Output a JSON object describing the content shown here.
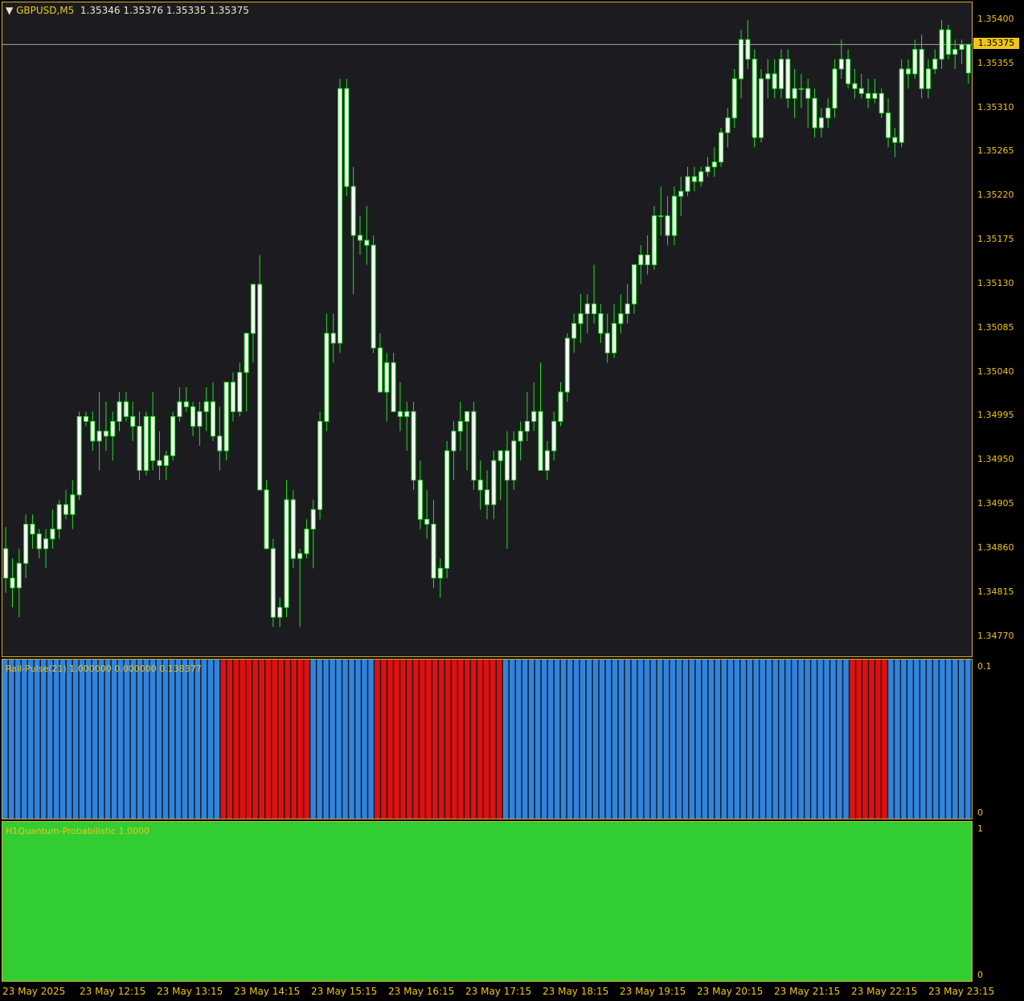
{
  "main": {
    "symbol": "GBPUSD,M5",
    "ohlc": "1.35346 1.35376 1.35335 1.35375",
    "current_price": "1.35375",
    "price_min": 1.3475,
    "price_max": 1.35418,
    "price_labels": [
      "1.35400",
      "1.35355",
      "1.35310",
      "1.35265",
      "1.35220",
      "1.35175",
      "1.35130",
      "1.35085",
      "1.35040",
      "1.34995",
      "1.34950",
      "1.34905",
      "1.34860",
      "1.34815",
      "1.34770"
    ],
    "colors": {
      "background": "#1c1c20",
      "bull_body": "#ffffff",
      "bear_body": "#ffffff",
      "wick": "#22e022",
      "bid_line": "#a0a0a0"
    }
  },
  "pulse": {
    "title": "Rail-Pulse(21) 1.000000 0.000000 0.138377",
    "axis_top": "0.1",
    "axis_bottom": "0",
    "colors": {
      "up": "#2f84e0",
      "down": "#e01010"
    }
  },
  "quantum": {
    "title": "H1Quantum-Probabilistic 1.0000",
    "axis_top": "1",
    "axis_bottom": "0",
    "value": 1.0,
    "colors": {
      "fill": "#32cd32"
    }
  },
  "time_axis": {
    "labels": [
      "23 May 2025",
      "23 May 12:15",
      "23 May 13:15",
      "23 May 14:15",
      "23 May 15:15",
      "23 May 16:15",
      "23 May 17:15",
      "23 May 18:15",
      "23 May 19:15",
      "23 May 20:15",
      "23 May 21:15",
      "23 May 22:15",
      "23 May 23:15"
    ]
  },
  "chart_data": {
    "type": "candlestick",
    "title": "GBPUSD,M5",
    "x_labels": [
      "23 May 2025",
      "23 May 12:15",
      "23 May 13:15",
      "23 May 14:15",
      "23 May 15:15",
      "23 May 16:15",
      "23 May 17:15",
      "23 May 18:15",
      "23 May 19:15",
      "23 May 20:15",
      "23 May 21:15",
      "23 May 22:15",
      "23 May 23:15"
    ],
    "ylim": [
      1.3475,
      1.35418
    ],
    "candles": [
      [
        1.3486,
        1.34882,
        1.34815,
        1.3483
      ],
      [
        1.3483,
        1.3485,
        1.348,
        1.3482
      ],
      [
        1.3482,
        1.3486,
        1.3479,
        1.34845
      ],
      [
        1.34845,
        1.34895,
        1.3483,
        1.34885
      ],
      [
        1.34885,
        1.34895,
        1.3486,
        1.34875
      ],
      [
        1.34875,
        1.3488,
        1.3485,
        1.3486
      ],
      [
        1.3486,
        1.3488,
        1.3484,
        1.3487
      ],
      [
        1.3487,
        1.349,
        1.3486,
        1.3488
      ],
      [
        1.3488,
        1.3491,
        1.3487,
        1.34905
      ],
      [
        1.34905,
        1.3492,
        1.3489,
        1.34895
      ],
      [
        1.34895,
        1.3493,
        1.3488,
        1.34915
      ],
      [
        1.34915,
        1.35,
        1.3491,
        1.34995
      ],
      [
        1.34995,
        1.35,
        1.34985,
        1.3499
      ],
      [
        1.3499,
        1.35,
        1.3496,
        1.3497
      ],
      [
        1.3497,
        1.3502,
        1.3494,
        1.3498
      ],
      [
        1.3498,
        1.3501,
        1.3496,
        1.34975
      ],
      [
        1.34975,
        1.35,
        1.3495,
        1.3499
      ],
      [
        1.3499,
        1.3502,
        1.3498,
        1.3501
      ],
      [
        1.3501,
        1.3502,
        1.3499,
        1.34995
      ],
      [
        1.34995,
        1.3501,
        1.3497,
        1.34985
      ],
      [
        1.34985,
        1.35,
        1.3493,
        1.3494
      ],
      [
        1.3494,
        1.35,
        1.34935,
        1.34995
      ],
      [
        1.34995,
        1.3502,
        1.3494,
        1.3495
      ],
      [
        1.3495,
        1.3498,
        1.3493,
        1.34945
      ],
      [
        1.34945,
        1.3496,
        1.3493,
        1.34955
      ],
      [
        1.34955,
        1.35,
        1.3495,
        1.34995
      ],
      [
        1.34995,
        1.35025,
        1.3499,
        1.3501
      ],
      [
        1.3501,
        1.35025,
        1.35,
        1.35005
      ],
      [
        1.35005,
        1.3501,
        1.34975,
        1.34985
      ],
      [
        1.34985,
        1.3501,
        1.34965,
        1.35
      ],
      [
        1.35,
        1.35025,
        1.3498,
        1.3501
      ],
      [
        1.3501,
        1.3503,
        1.3497,
        1.34975
      ],
      [
        1.34975,
        1.35005,
        1.3494,
        1.3496
      ],
      [
        1.3496,
        1.3503,
        1.3495,
        1.3503
      ],
      [
        1.3503,
        1.3504,
        1.3499,
        1.35
      ],
      [
        1.35,
        1.3505,
        1.34995,
        1.3504
      ],
      [
        1.3504,
        1.3508,
        1.35,
        1.3508
      ],
      [
        1.3508,
        1.3513,
        1.3505,
        1.3513
      ],
      [
        1.3513,
        1.3516,
        1.3504,
        1.3492
      ],
      [
        1.3492,
        1.3493,
        1.3486,
        1.3486
      ],
      [
        1.3486,
        1.3487,
        1.3478,
        1.3479
      ],
      [
        1.3479,
        1.3481,
        1.3478,
        1.348
      ],
      [
        1.348,
        1.3493,
        1.3479,
        1.3491
      ],
      [
        1.3491,
        1.3492,
        1.3484,
        1.3485
      ],
      [
        1.3485,
        1.3486,
        1.3478,
        1.34855
      ],
      [
        1.34855,
        1.3489,
        1.3485,
        1.3488
      ],
      [
        1.3488,
        1.3491,
        1.3484,
        1.349
      ],
      [
        1.349,
        1.35,
        1.3489,
        1.3499
      ],
      [
        1.3499,
        1.351,
        1.3498,
        1.3508
      ],
      [
        1.3508,
        1.351,
        1.3505,
        1.3507
      ],
      [
        1.3507,
        1.3534,
        1.3506,
        1.3533
      ],
      [
        1.3533,
        1.3534,
        1.3522,
        1.3523
      ],
      [
        1.3523,
        1.3525,
        1.3512,
        1.3518
      ],
      [
        1.3518,
        1.352,
        1.3516,
        1.35175
      ],
      [
        1.35175,
        1.3521,
        1.3515,
        1.3517
      ],
      [
        1.3517,
        1.3518,
        1.3506,
        1.35065
      ],
      [
        1.35065,
        1.3508,
        1.3502,
        1.3502
      ],
      [
        1.3502,
        1.3506,
        1.3499,
        1.3505
      ],
      [
        1.3505,
        1.3506,
        1.35,
        1.35
      ],
      [
        1.35,
        1.3503,
        1.3498,
        1.34995
      ],
      [
        1.34995,
        1.3501,
        1.3496,
        1.35
      ],
      [
        1.35,
        1.3501,
        1.3492,
        1.3493
      ],
      [
        1.3493,
        1.3495,
        1.3488,
        1.3489
      ],
      [
        1.3489,
        1.3492,
        1.3487,
        1.34885
      ],
      [
        1.34885,
        1.3491,
        1.3482,
        1.3483
      ],
      [
        1.3483,
        1.3485,
        1.3481,
        1.3484
      ],
      [
        1.3484,
        1.3497,
        1.3483,
        1.3496
      ],
      [
        1.3496,
        1.3499,
        1.3493,
        1.3498
      ],
      [
        1.3498,
        1.3501,
        1.3496,
        1.3499
      ],
      [
        1.3499,
        1.35,
        1.3494,
        1.35
      ],
      [
        1.35,
        1.3501,
        1.3492,
        1.3493
      ],
      [
        1.3493,
        1.3495,
        1.349,
        1.3492
      ],
      [
        1.3492,
        1.3494,
        1.3489,
        1.34905
      ],
      [
        1.34905,
        1.3496,
        1.3489,
        1.3495
      ],
      [
        1.3495,
        1.3496,
        1.3491,
        1.3496
      ],
      [
        1.3496,
        1.3498,
        1.3486,
        1.3493
      ],
      [
        1.3493,
        1.3498,
        1.3492,
        1.3497
      ],
      [
        1.3497,
        1.3499,
        1.3495,
        1.3498
      ],
      [
        1.3498,
        1.3502,
        1.3497,
        1.3499
      ],
      [
        1.3499,
        1.3503,
        1.3498,
        1.35
      ],
      [
        1.35,
        1.3505,
        1.3494,
        1.3494
      ],
      [
        1.3494,
        1.3497,
        1.3493,
        1.3496
      ],
      [
        1.3496,
        1.35,
        1.3495,
        1.3499
      ],
      [
        1.3499,
        1.3503,
        1.34985,
        1.3502
      ],
      [
        1.3502,
        1.3508,
        1.3501,
        1.35075
      ],
      [
        1.35075,
        1.351,
        1.3506,
        1.3509
      ],
      [
        1.3509,
        1.3512,
        1.3507,
        1.351
      ],
      [
        1.351,
        1.3512,
        1.3508,
        1.3511
      ],
      [
        1.3511,
        1.3515,
        1.3509,
        1.351
      ],
      [
        1.351,
        1.3511,
        1.3507,
        1.3508
      ],
      [
        1.3508,
        1.351,
        1.3505,
        1.3506
      ],
      [
        1.3506,
        1.3511,
        1.35055,
        1.3509
      ],
      [
        1.3509,
        1.3512,
        1.3508,
        1.351
      ],
      [
        1.351,
        1.3513,
        1.3509,
        1.3511
      ],
      [
        1.3511,
        1.3515,
        1.351,
        1.3515
      ],
      [
        1.3515,
        1.3517,
        1.3513,
        1.3516
      ],
      [
        1.3516,
        1.3518,
        1.3514,
        1.3515
      ],
      [
        1.3515,
        1.3521,
        1.35145,
        1.352
      ],
      [
        1.352,
        1.3523,
        1.3518,
        1.352
      ],
      [
        1.352,
        1.3522,
        1.3517,
        1.3518
      ],
      [
        1.3518,
        1.3523,
        1.3517,
        1.3522
      ],
      [
        1.3522,
        1.3524,
        1.352,
        1.35225
      ],
      [
        1.35225,
        1.3525,
        1.3522,
        1.3524
      ],
      [
        1.3524,
        1.3525,
        1.35225,
        1.35235
      ],
      [
        1.35235,
        1.3525,
        1.3523,
        1.35245
      ],
      [
        1.35245,
        1.3526,
        1.3524,
        1.3525
      ],
      [
        1.3525,
        1.3527,
        1.3524,
        1.35255
      ],
      [
        1.35255,
        1.3529,
        1.3525,
        1.35285
      ],
      [
        1.35285,
        1.3531,
        1.3527,
        1.353
      ],
      [
        1.353,
        1.3535,
        1.3529,
        1.3534
      ],
      [
        1.3534,
        1.3539,
        1.3532,
        1.3538
      ],
      [
        1.3538,
        1.354,
        1.3535,
        1.3536
      ],
      [
        1.3536,
        1.3537,
        1.3527,
        1.3528
      ],
      [
        1.3528,
        1.3535,
        1.35275,
        1.3534
      ],
      [
        1.3534,
        1.3536,
        1.3532,
        1.35345
      ],
      [
        1.35345,
        1.3536,
        1.3532,
        1.3533
      ],
      [
        1.3533,
        1.3537,
        1.3532,
        1.3536
      ],
      [
        1.3536,
        1.3537,
        1.3531,
        1.3532
      ],
      [
        1.3532,
        1.3535,
        1.353,
        1.3533
      ],
      [
        1.3533,
        1.35345,
        1.3531,
        1.3533
      ],
      [
        1.3533,
        1.3534,
        1.3529,
        1.3532
      ],
      [
        1.3532,
        1.3533,
        1.3528,
        1.3529
      ],
      [
        1.3529,
        1.3531,
        1.3528,
        1.353
      ],
      [
        1.353,
        1.3532,
        1.3529,
        1.3531
      ],
      [
        1.3531,
        1.3536,
        1.353,
        1.3535
      ],
      [
        1.3535,
        1.3538,
        1.3534,
        1.3536
      ],
      [
        1.3536,
        1.3537,
        1.3533,
        1.35335
      ],
      [
        1.35335,
        1.3535,
        1.3532,
        1.3533
      ],
      [
        1.3533,
        1.35345,
        1.3532,
        1.35325
      ],
      [
        1.35325,
        1.3534,
        1.3531,
        1.3532
      ],
      [
        1.3532,
        1.3534,
        1.35315,
        1.35325
      ],
      [
        1.35325,
        1.3533,
        1.353,
        1.35305
      ],
      [
        1.35305,
        1.3532,
        1.3527,
        1.3528
      ],
      [
        1.3528,
        1.3529,
        1.3526,
        1.35275
      ],
      [
        1.35275,
        1.3536,
        1.3527,
        1.3535
      ],
      [
        1.3535,
        1.3536,
        1.3533,
        1.35345
      ],
      [
        1.35345,
        1.3538,
        1.3534,
        1.3537
      ],
      [
        1.3537,
        1.35385,
        1.3532,
        1.3533
      ],
      [
        1.3533,
        1.3536,
        1.3532,
        1.3535
      ],
      [
        1.3535,
        1.3537,
        1.35345,
        1.3536
      ],
      [
        1.3536,
        1.354,
        1.3535,
        1.3539
      ],
      [
        1.3539,
        1.35395,
        1.3536,
        1.35365
      ],
      [
        1.35365,
        1.3538,
        1.3535,
        1.3537
      ],
      [
        1.3537,
        1.3538,
        1.35355,
        1.35375
      ],
      [
        1.35346,
        1.35376,
        1.35335,
        1.35375
      ]
    ],
    "rail_pulse": {
      "ylim": [
        0,
        0.1
      ],
      "segments": [
        {
          "state": "up",
          "bars": 34
        },
        {
          "state": "down",
          "bars": 14
        },
        {
          "state": "up",
          "bars": 10
        },
        {
          "state": "down",
          "bars": 20
        },
        {
          "state": "up",
          "bars": 54
        },
        {
          "state": "down",
          "bars": 6
        },
        {
          "state": "up",
          "bars": 13
        }
      ]
    }
  }
}
